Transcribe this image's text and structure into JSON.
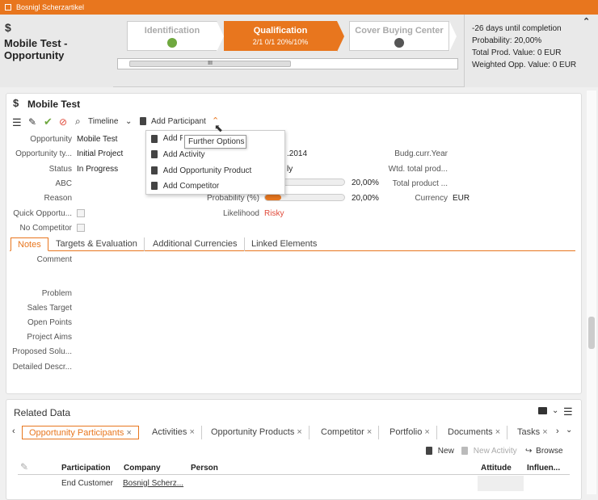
{
  "window": {
    "title": "Bosnigl Scherzartikel"
  },
  "header": {
    "record_name": "Mobile Test - Opportunity",
    "phases": [
      {
        "label": "Identification",
        "active": false
      },
      {
        "label": "Qualification",
        "active": true,
        "kpis": "2/1  0/1  20%/10%"
      },
      {
        "label": "Cover Buying Center",
        "active": false
      }
    ],
    "scroll_grip": "III",
    "info": [
      "-26 days until completion",
      "Probability: 20,00%",
      "Total Prod. Value: 0 EUR",
      "Weighted Opp. Value: 0 EUR"
    ]
  },
  "detail": {
    "title": "Mobile Test",
    "toolbar": {
      "timeline": "Timeline",
      "add_participant": "Add Participant"
    },
    "dropdown": [
      "Add Participant",
      "Add Activity",
      "Add Opportunity Product",
      "Add Competitor"
    ],
    "tooltip": "Further Options",
    "fields": {
      "opportunity_label": "Opportunity",
      "opportunity_value": "Mobile Test",
      "type_label": "Opportunity ty...",
      "type_value": "Initial Project",
      "status_label": "Status",
      "status_value": "In Progress",
      "abc_label": "ABC",
      "reason_label": "Reason",
      "quick_label": "Quick Opportu...",
      "nocomp_label": "No Competitor",
      "date_fragment": ".2014",
      "ly_fragment": "ly",
      "prob_label": "Probability (%)",
      "likelihood_label": "Likelihood",
      "likelihood_value": "Risky",
      "bar1_value": "20,00%",
      "bar2_value": "20,00%",
      "budg_label": "Budg.curr.Year",
      "wtd_label": "Wtd. total prod...",
      "total_label": "Total product ...",
      "currency_label": "Currency",
      "currency_value": "EUR"
    },
    "progress": {
      "bar1": 0.2,
      "bar2": 0.2
    },
    "tabs": [
      "Notes",
      "Targets & Evaluation",
      "Additional Currencies",
      "Linked Elements"
    ],
    "notes": [
      "Comment",
      "Problem",
      "Sales Target",
      "Open Points",
      "Project Aims",
      "Proposed Solu...",
      "Detailed Descr..."
    ]
  },
  "related": {
    "title": "Related Data",
    "tabs": [
      "Opportunity Participants",
      "Activities",
      "Opportunity Products",
      "Competitor",
      "Portfolio",
      "Documents",
      "Tasks"
    ],
    "actions": {
      "new": "New",
      "new_activity": "New Activity",
      "browse": "Browse"
    },
    "columns": [
      "Participation",
      "Company",
      "Person",
      "Attitude",
      "Influen..."
    ],
    "rows": [
      {
        "participation": "End Customer",
        "company": "Bosnigl Scherz..."
      }
    ]
  },
  "colors": {
    "accent": "#e8761e",
    "green": "#6fa83f",
    "risky": "#e04a3a"
  }
}
